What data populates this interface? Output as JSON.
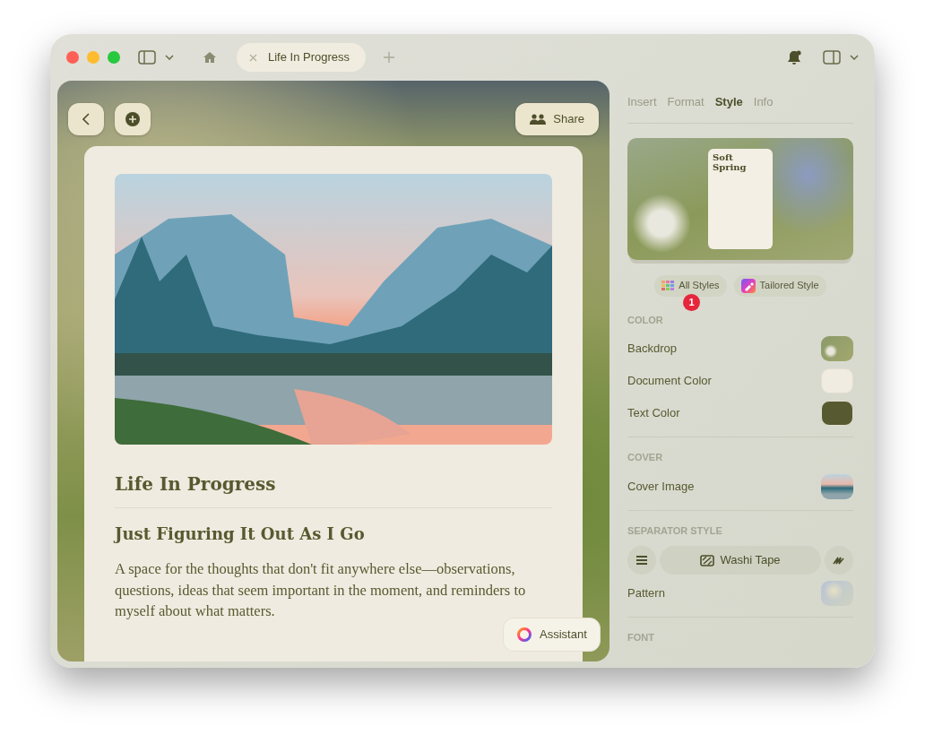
{
  "window": {
    "tabs": [
      {
        "label": "Life In Progress",
        "selected": true
      }
    ]
  },
  "document": {
    "title": "Life In Progress",
    "subtitle": "Just Figuring It Out As I Go",
    "body": "A space for the thoughts that don't fit anywhere else—observations, questions, ideas that seem important in the moment, and reminders to myself about what matters."
  },
  "share_button": {
    "label": "Share"
  },
  "assistant_button": {
    "label": "Assistant"
  },
  "inspector_tabs": [
    {
      "label": "Insert",
      "selected": false
    },
    {
      "label": "Format",
      "selected": false
    },
    {
      "label": "Style",
      "selected": true
    },
    {
      "label": "Info",
      "selected": false
    }
  ],
  "style_preview": {
    "title": "Soft Spring"
  },
  "style_buttons": [
    {
      "label": "All Styles",
      "kind": "grid",
      "badge": "1"
    },
    {
      "label": "Tailored Style",
      "kind": "brush"
    }
  ],
  "sections": [
    {
      "heading": "COLOR",
      "rows": [
        {
          "kind": "image",
          "label": "Backdrop"
        },
        {
          "kind": "color",
          "label": "Document Color",
          "color": "#f0ece2"
        },
        {
          "kind": "color",
          "label": "Text Color",
          "color": "#575a30"
        }
      ]
    },
    {
      "heading": "COVER",
      "rows": [
        {
          "kind": "photo",
          "label": "Cover Image"
        }
      ]
    },
    {
      "heading": "SEPARATOR STYLE",
      "rows": [
        {
          "kind": "segmented",
          "label": "Washi Tape"
        },
        {
          "kind": "pattern",
          "label": "Pattern"
        }
      ]
    },
    {
      "heading": "FONT"
    }
  ]
}
